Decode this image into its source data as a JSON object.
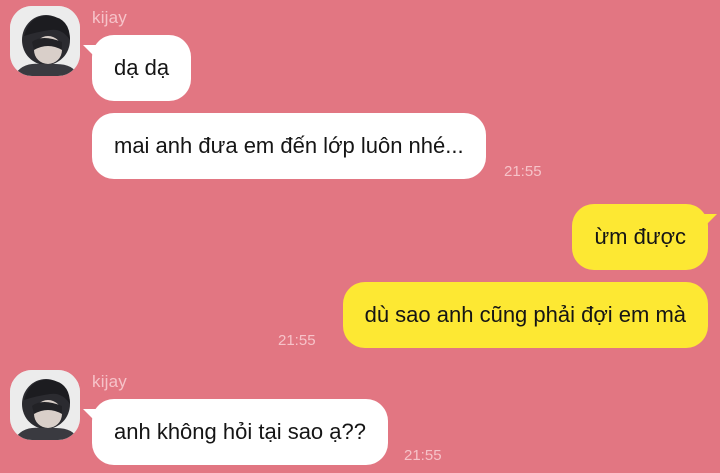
{
  "chat": {
    "messages": [
      {
        "sender": "kijay",
        "text": "dạ dạ"
      },
      {
        "text": "mai anh đưa em đến lớp luôn nhé...",
        "time": "21:55"
      },
      {
        "text": "ừm được"
      },
      {
        "text": "dù sao anh cũng phải đợi em mà",
        "time": "21:55"
      },
      {
        "sender": "kijay",
        "text": "anh không hỏi tại sao ạ??",
        "time": "21:55"
      }
    ]
  },
  "colors": {
    "background": "#e27682",
    "incoming_bubble": "#ffffff",
    "outgoing_bubble": "#fde833",
    "meta_text": "#f6c3c9"
  }
}
